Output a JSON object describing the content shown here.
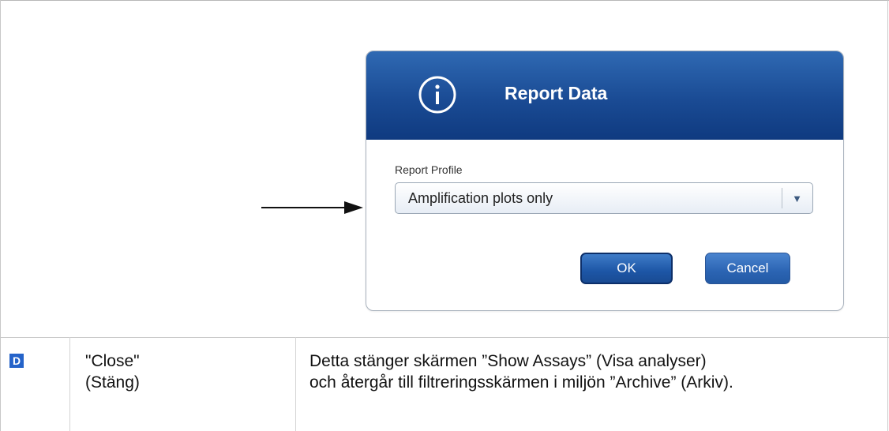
{
  "dialog": {
    "title": "Report Data",
    "icon": "info-icon",
    "profile_label": "Report Profile",
    "profile_value": "Amplification plots only",
    "ok_label": "OK",
    "cancel_label": "Cancel",
    "colors": {
      "header": "#1a4b94",
      "button": "#2b64b3"
    }
  },
  "row": {
    "badge": "D",
    "name_line1": "\"Close\"",
    "name_line2": "(Stäng)",
    "desc_line1": "Detta stänger skärmen ”Show Assays” (Visa analyser)",
    "desc_line2": "och återgår till filtreringsskärmen i miljön ”Archive” (Arkiv)."
  }
}
